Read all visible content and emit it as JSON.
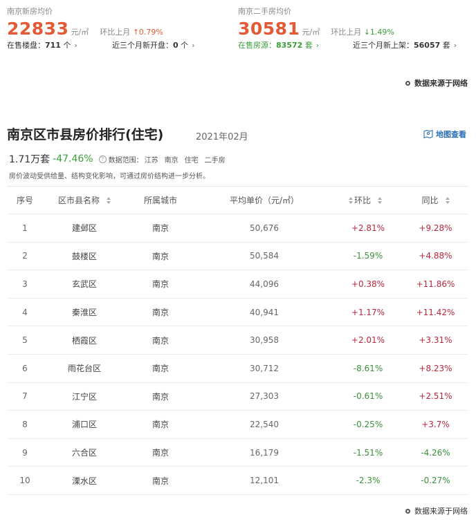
{
  "stats": {
    "new": {
      "title": "南京新房均价",
      "price": "22833",
      "unit": "元/㎡",
      "mom_label": "环比上月",
      "mom_arrow": "↑",
      "mom_value": "0.79%",
      "on_sale_label": "在售楼盘：",
      "on_sale_value": "711",
      "on_sale_unit": "个",
      "recent_label": "近三个月新开盘：",
      "recent_value": "0",
      "recent_unit": "个",
      "chevron": "›"
    },
    "second": {
      "title": "南京二手房均价",
      "price": "30581",
      "unit": "元/㎡",
      "mom_label": "环比上月",
      "mom_arrow": "↓",
      "mom_value": "1.49%",
      "on_sale_label": "在售房源：",
      "on_sale_value": "83572",
      "on_sale_unit": "套",
      "recent_label": "近三个月新上架：",
      "recent_value": "56057",
      "recent_unit": "套",
      "chevron": "›"
    }
  },
  "source_label": "数据来源于网络",
  "ranking": {
    "title": "南京区市县房价排行(住宅)",
    "date": "2021年02月",
    "map_link": "地图查看",
    "count": "1.71万套",
    "change": "-47.46%",
    "scope_label": "数据范围：",
    "scope_items": [
      "江苏",
      "南京",
      "住宅",
      "二手房"
    ],
    "note": "房价波动受供给量、结构变化影响，可通过房价结构进一步分析。",
    "columns": {
      "no": "序号",
      "name": "区市县名称",
      "city": "所属城市",
      "price": "平均单价（元/㎡）",
      "mom": "环比",
      "yoy": "同比"
    },
    "rows": [
      {
        "no": "1",
        "name": "建邺区",
        "city": "南京",
        "price": "50,676",
        "mom": "+2.81%",
        "yoy": "+9.28%"
      },
      {
        "no": "2",
        "name": "鼓楼区",
        "city": "南京",
        "price": "50,584",
        "mom": "-1.59%",
        "yoy": "+4.88%"
      },
      {
        "no": "3",
        "name": "玄武区",
        "city": "南京",
        "price": "44,096",
        "mom": "+0.38%",
        "yoy": "+11.86%"
      },
      {
        "no": "4",
        "name": "秦淮区",
        "city": "南京",
        "price": "40,941",
        "mom": "+1.17%",
        "yoy": "+11.42%"
      },
      {
        "no": "5",
        "name": "栖霞区",
        "city": "南京",
        "price": "30,958",
        "mom": "+2.01%",
        "yoy": "+3.31%"
      },
      {
        "no": "6",
        "name": "雨花台区",
        "city": "南京",
        "price": "30,712",
        "mom": "-8.61%",
        "yoy": "+8.23%"
      },
      {
        "no": "7",
        "name": "江宁区",
        "city": "南京",
        "price": "27,303",
        "mom": "-0.61%",
        "yoy": "+2.51%"
      },
      {
        "no": "8",
        "name": "浦口区",
        "city": "南京",
        "price": "22,540",
        "mom": "-0.25%",
        "yoy": "+3.7%"
      },
      {
        "no": "9",
        "name": "六合区",
        "city": "南京",
        "price": "16,179",
        "mom": "-1.51%",
        "yoy": "-4.26%"
      },
      {
        "no": "10",
        "name": "溧水区",
        "city": "南京",
        "price": "12,101",
        "mom": "-2.3%",
        "yoy": "-0.27%"
      }
    ]
  },
  "colors": {
    "price_red": "#e35a37",
    "positive": "#b8283c",
    "negative": "#3a8f3a",
    "green_text": "#3a9d3a",
    "link_blue": "#2a6fb8"
  }
}
